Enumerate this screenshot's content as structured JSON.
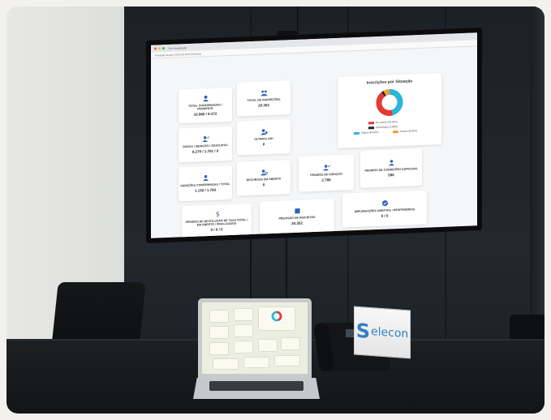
{
  "browser": {
    "tab_title": "Tela Visualização",
    "address": "Wordpad Imagem 2020-06-18 9:13:45.png"
  },
  "dashboard": {
    "cards": [
      {
        "label": "TOTAL CONFIRMADOS / PENDENTE",
        "value": "10.980 / 9.372"
      },
      {
        "label": "TOTAL DE INSCRIÇÕES",
        "value": "20.352"
      },
      {
        "label": "PAGAS / ISENÇÃO / GRATUITAS",
        "value": "9.279 / 1.701 / 0"
      },
      {
        "label": "ÚLTIMAS 24H",
        "value": "0"
      },
      {
        "label": "ISENÇÕES CONFIRMADAS / TOTAL",
        "value": "1.130 / 1.793"
      },
      {
        "label": "RECURSOS EM ABERTO",
        "value": "0"
      },
      {
        "label": "PEDIDOS DE ISENÇÃO",
        "value": "2.788"
      },
      {
        "label": "PEDIDOS DE CONDIÇÕES ESPECIAIS",
        "value": "596"
      },
      {
        "label": "PEDIDOS DE DEVOLUÇÃO DE TAXA TOTAL / EM ABERTO / FINALIZADOS",
        "value": "0 / 0 / 0"
      },
      {
        "label": "PREVISÃO DE INSCRITOS",
        "value": "20.352"
      },
      {
        "label": "IMPUGNAÇÕES ABERTAS / RESPONDIDAS",
        "value": "0 / 0"
      }
    ],
    "pie": {
      "title": "Inscrições por Situação",
      "legend": [
        {
          "label": "Em aberto (43.35%)",
          "color": "#e53935",
          "value": 43.35
        },
        {
          "label": "Cancelados (2.88%)",
          "color": "#222222",
          "value": 2.88
        },
        {
          "label": "Pagos (45.59%)",
          "color": "#29b6d8",
          "value": 45.59
        },
        {
          "label": "Isentos (8.36%)",
          "color": "#f39c3c",
          "value": 8.36
        }
      ]
    }
  },
  "sign": {
    "brand": "elecon",
    "mark": "S",
    "color": "#2f7fc8"
  },
  "colors": {
    "accent": "#2f62b3",
    "wall": "#1e2328"
  }
}
